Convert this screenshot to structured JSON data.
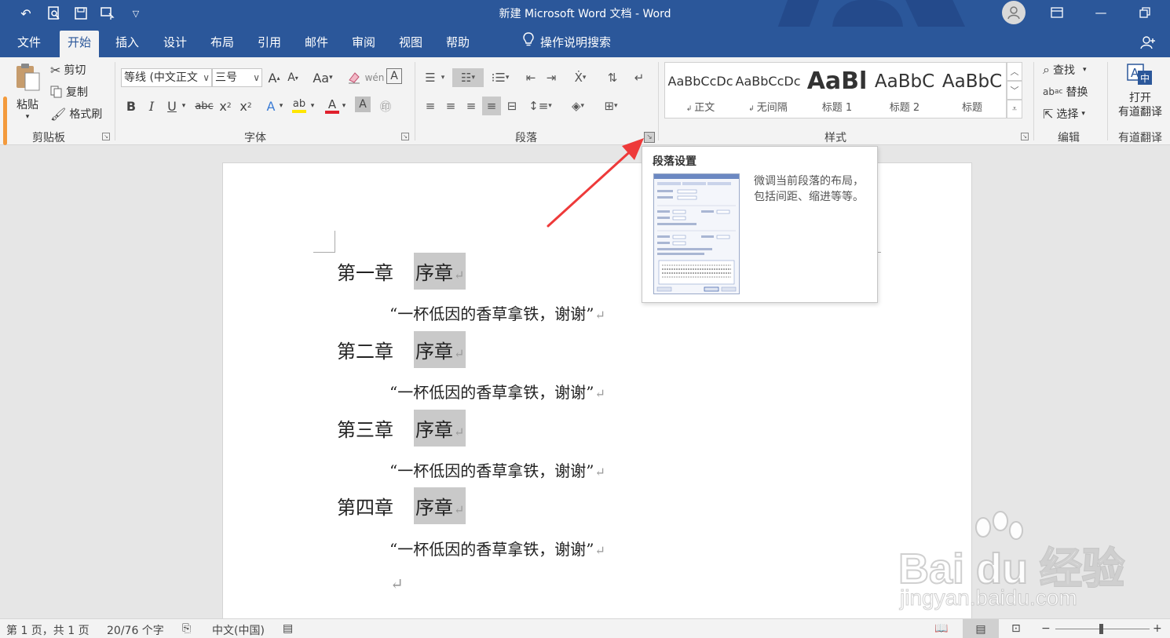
{
  "window": {
    "title": "新建 Microsoft Word 文档  -  Word"
  },
  "quick_access": {
    "icons": [
      "undo-icon",
      "print-preview-icon",
      "save-icon",
      "touch-mode-icon",
      "customize-icon"
    ]
  },
  "tabs": [
    {
      "label": "文件"
    },
    {
      "label": "开始",
      "active": true
    },
    {
      "label": "插入"
    },
    {
      "label": "设计"
    },
    {
      "label": "布局"
    },
    {
      "label": "引用"
    },
    {
      "label": "邮件"
    },
    {
      "label": "审阅"
    },
    {
      "label": "视图"
    },
    {
      "label": "帮助"
    }
  ],
  "tell_me": {
    "label": "操作说明搜索"
  },
  "ribbon": {
    "clipboard": {
      "paste": "粘贴",
      "cut": "剪切",
      "copy": "复制",
      "format_painter": "格式刷",
      "label": "剪贴板"
    },
    "font": {
      "font_name": "等线 (中文正文",
      "font_size": "三号",
      "change_case": "Aa",
      "label": "字体"
    },
    "paragraph": {
      "label": "段落"
    },
    "styles": {
      "label": "样式",
      "items": [
        {
          "sample": "AaBbCcDc",
          "name": "正文"
        },
        {
          "sample": "AaBbCcDc",
          "name": "无间隔"
        },
        {
          "sample": "AaBl",
          "name": "标题 1"
        },
        {
          "sample": "AaBbC",
          "name": "标题 2"
        },
        {
          "sample": "AaBbC",
          "name": "标题"
        }
      ]
    },
    "editing": {
      "find": "查找",
      "replace": "替换",
      "select": "选择",
      "label": "编辑"
    },
    "youdao": {
      "line1": "打开",
      "line2": "有道翻译",
      "label": "有道翻译"
    }
  },
  "tooltip": {
    "title": "段落设置",
    "description": "微调当前段落的布局，包括间距、缩进等等。"
  },
  "document": {
    "chapters": [
      {
        "number": "第一章",
        "title": "序章",
        "body": "“一杯低因的香草拿铁，谢谢”"
      },
      {
        "number": "第二章",
        "title": "序章",
        "body": "“一杯低因的香草拿铁，谢谢”"
      },
      {
        "number": "第三章",
        "title": "序章",
        "body": "“一杯低因的香草拿铁，谢谢”"
      },
      {
        "number": "第四章",
        "title": "序章",
        "body": "“一杯低因的香草拿铁，谢谢”"
      }
    ],
    "paragraph_mark": "↵"
  },
  "status": {
    "page": "第 1 页，共 1 页",
    "words": "20/76 个字",
    "language": "中文(中国)"
  },
  "watermark": {
    "logo": "Bai du 经验",
    "url": "jingyan.baidu.com"
  },
  "colors": {
    "accent": "#2b579a",
    "highlight": "#c9c9c9",
    "arrow": "#ee3a3a"
  }
}
